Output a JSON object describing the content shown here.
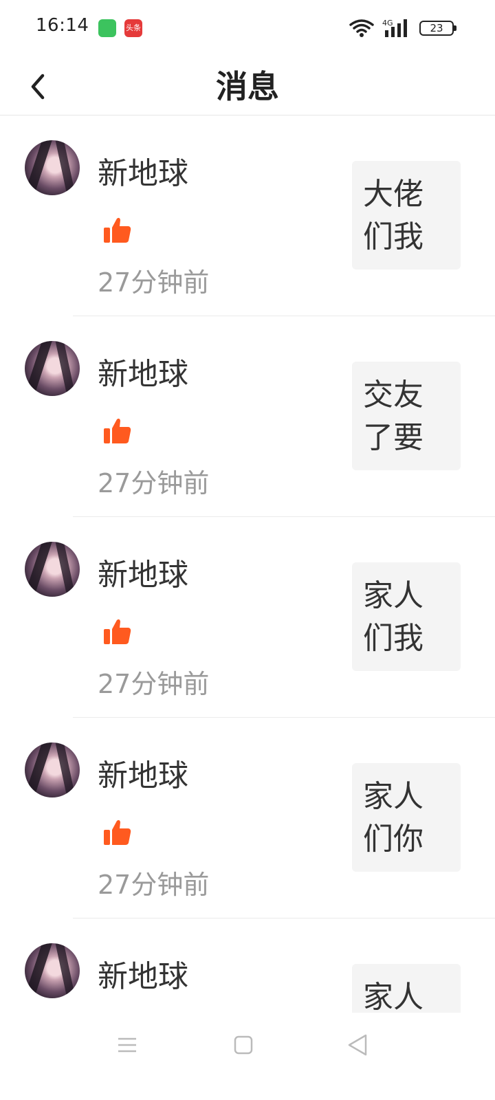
{
  "status_bar": {
    "time": "16:14",
    "app_badge_text": "头条",
    "battery": "23"
  },
  "header": {
    "title": "消息"
  },
  "messages": [
    {
      "username": "新地球",
      "time": "27分钟前",
      "preview": "大佬们我",
      "icon": "thumbs-up-icon"
    },
    {
      "username": "新地球",
      "time": "27分钟前",
      "preview": "交友了要",
      "icon": "thumbs-up-icon"
    },
    {
      "username": "新地球",
      "time": "27分钟前",
      "preview": "家人们我",
      "icon": "thumbs-up-icon"
    },
    {
      "username": "新地球",
      "time": "27分钟前",
      "preview": "家人们你",
      "icon": "thumbs-up-icon"
    },
    {
      "username": "新地球",
      "time": "",
      "preview": "家人",
      "icon": "thumbs-up-icon"
    }
  ],
  "colors": {
    "like": "#ff5a1f",
    "secondary_text": "#9a9a9a",
    "preview_bg": "#f4f4f4"
  }
}
